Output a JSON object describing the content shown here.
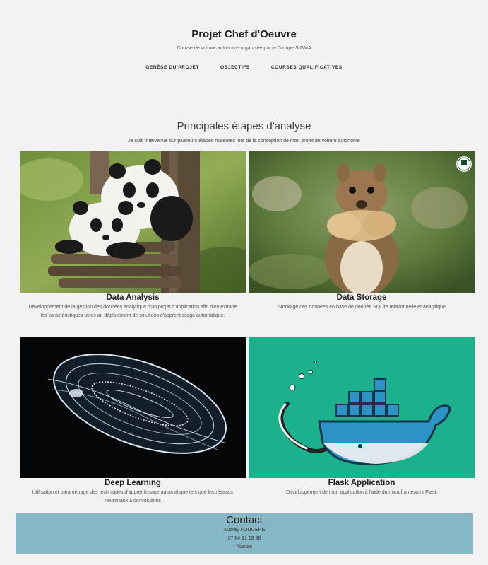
{
  "header": {
    "title": "Projet Chef d'Oeuvre",
    "subtitle": "Course de voiture autonome organisée par le Groupe SIGMA"
  },
  "nav": {
    "items": [
      {
        "label": "GENÈSE DU PROJET"
      },
      {
        "label": "OBJECTIFS"
      },
      {
        "label": "COURSES QUALIFICATIVES"
      }
    ]
  },
  "section": {
    "title": "Principales étapes d'analyse",
    "subtitle": "Je suis intervenue sur plusieurs étapes majeures lors de la conception de mon projet de voiture autonome"
  },
  "cards": [
    {
      "title": "Data Analysis",
      "image": "panda-photo",
      "description": "Développement de la gestion des données analytique d'un projet d'application afin d'en extraire les caractéristiques utiles au déploiement de solutions d'apprentissage automatique."
    },
    {
      "title": "Data Storage",
      "image": "squirrel-photo",
      "description": "Stockage des données en base de donnée SQLite relationnelle et analytique"
    },
    {
      "title": "Deep Learning",
      "image": "jellyfish-photo",
      "description": "Utilisation et paramétrage des techniques d'apprentissage automatique tels que les réseaux neuronaux à convolutions"
    },
    {
      "title": "Flask Application",
      "image": "docker-whale-illustration",
      "description": "Développement de mon application à l'aide du microframework Flask"
    }
  ],
  "contact": {
    "title": "Contact",
    "name": "Audrey FOUGERE",
    "phone": "07 84 91 19 98",
    "city": "Nantes"
  },
  "colors": {
    "background": "#f2f2f2",
    "contact_bg": "#86b7c6",
    "flask_bg": "#1bb18c"
  }
}
